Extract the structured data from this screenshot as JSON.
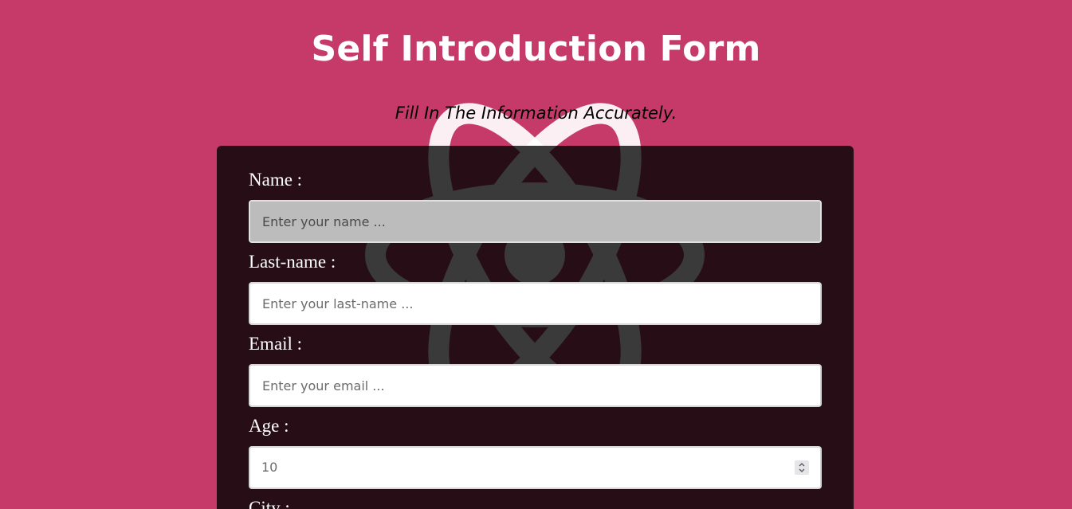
{
  "page": {
    "title": "Self Introduction Form",
    "subtitle": "Fill In The Information Accurately.",
    "background_color": "#c63a69",
    "card_color": "#1a0a10"
  },
  "watermark": {
    "icon": "react-logo-icon"
  },
  "form": {
    "name": {
      "label": "Name :",
      "placeholder": "Enter your name ..."
    },
    "last_name": {
      "label": "Last-name :",
      "placeholder": "Enter your last-name ..."
    },
    "email": {
      "label": "Email :",
      "placeholder": "Enter your email ..."
    },
    "age": {
      "label": "Age :",
      "value": "10"
    },
    "city": {
      "label": "City :"
    }
  }
}
